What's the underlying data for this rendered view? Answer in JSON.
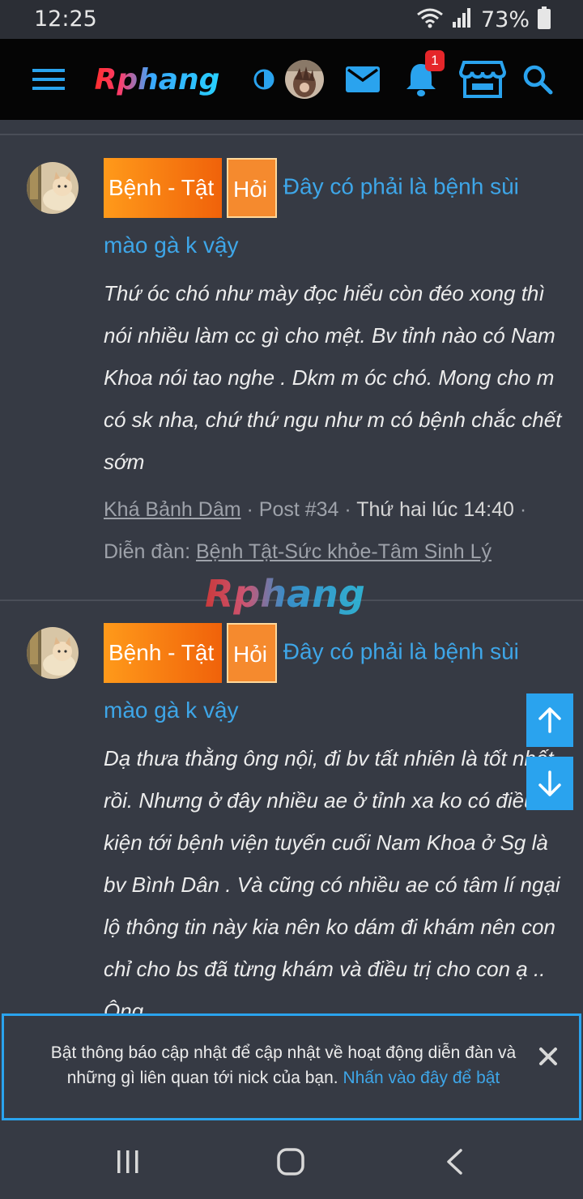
{
  "status_bar": {
    "time": "12:25",
    "battery_percent": "73%",
    "icons": [
      "wifi-icon",
      "signal-icon",
      "battery-icon"
    ]
  },
  "header": {
    "logo_text": "Rphang",
    "notification_count": "1",
    "icons": [
      "menu-icon",
      "theme-toggle-icon",
      "avatar",
      "mail-icon",
      "bell-icon",
      "store-icon",
      "search-icon"
    ],
    "accent_color": "#2aa3ee"
  },
  "posts": [
    {
      "tag_category": "Bệnh - Tật",
      "tag_type": "Hỏi",
      "title_line1": "Đây có phải là bệnh sùi",
      "title_line2": "mào gà k vậy",
      "body": [
        "Thứ óc chó như mày đọc hiểu còn đéo xong thì",
        "nói nhiều làm cc gì cho mệt. Bv tỉnh nào có Nam",
        "Khoa nói tao nghe . Dkm m óc chó. Mong cho m",
        "có sk nha, chứ thứ ngu như m có bệnh chắc chết",
        "sớm"
      ],
      "author": "Khá Bảnh Dâm",
      "post_number": "Post #34",
      "date": "Thứ hai lúc 14:40",
      "forum_label": "Diễn đàn:",
      "forum_name": "Bệnh Tật-Sức khỏe-Tâm Sinh Lý"
    },
    {
      "tag_category": "Bệnh - Tật",
      "tag_type": "Hỏi",
      "title_line1": "Đây có phải là bệnh sùi",
      "title_line2": "mào gà k vậy",
      "body": [
        "Dạ thưa thằng ông nội, đi bv tất nhiên là tốt nhất",
        "rồi. Nhưng ở đây nhiều ae ở tỉnh xa ko có điều",
        "kiện tới bệnh viện tuyến cuối Nam Khoa ở Sg là",
        "bv Bình Dân . Và cũng có nhiều ae có tâm lí ngại",
        "lộ thông tin này kia nên ko dám đi khám nên con",
        "chỉ cho bs đã từng khám và điều trị cho con ạ ..",
        "Ông"
      ]
    }
  ],
  "watermark": "Rphang",
  "notification_banner": {
    "text": "Bật thông báo cập nhật để cập nhật về hoạt động diễn đàn và những gì liên quan tới nick của bạn.",
    "link": "Nhấn vào đây để bật"
  },
  "nav_bar": {
    "icons": [
      "recent-apps-icon",
      "home-icon",
      "back-icon"
    ]
  }
}
